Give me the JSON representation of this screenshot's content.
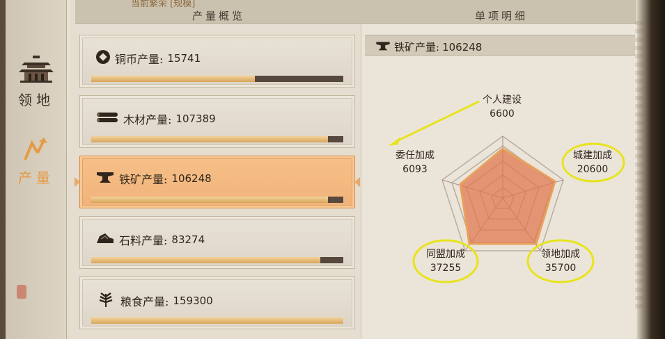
{
  "header": {
    "top_partial": "当前繁荣  [规模]",
    "left_title": "产量概览",
    "right_title": "单项明细"
  },
  "sidebar": {
    "items": [
      {
        "label": "领地",
        "icon": "palace-icon",
        "active": false
      },
      {
        "label": "产量",
        "icon": "arrow-up-right-icon",
        "active": true
      }
    ]
  },
  "production": [
    {
      "label": "铜币产量:",
      "value": "15741",
      "icon": "coin-icon",
      "fill": 0.65,
      "active": false
    },
    {
      "label": "木材产量:",
      "value": "107389",
      "icon": "wood-icon",
      "fill": 0.94,
      "active": false
    },
    {
      "label": "铁矿产量:",
      "value": "106248",
      "icon": "anvil-icon",
      "fill": 0.94,
      "active": true
    },
    {
      "label": "石料产量:",
      "value": "83274",
      "icon": "stone-icon",
      "fill": 0.91,
      "active": false
    },
    {
      "label": "粮食产量:",
      "value": "159300",
      "icon": "grain-icon",
      "fill": 1.0,
      "active": false
    }
  ],
  "detail": {
    "label": "铁矿产量:",
    "value": "106248",
    "icon": "anvil-icon"
  },
  "radar": {
    "axes": [
      {
        "label": "个人建设",
        "value": "6600"
      },
      {
        "label": "城建加成",
        "value": "20600"
      },
      {
        "label": "领地加成",
        "value": "35700"
      },
      {
        "label": "同盟加成",
        "value": "37255"
      },
      {
        "label": "委任加成",
        "value": "6093"
      }
    ]
  },
  "colors": {
    "accent": "#e59b45",
    "active_card": "#f0b37a",
    "radar_fill": "#e0784f",
    "highlight_circle": "#e8e31c"
  }
}
